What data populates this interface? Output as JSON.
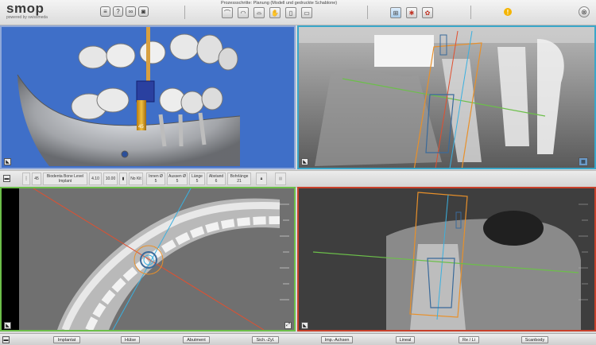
{
  "app": {
    "logo_text": "smop",
    "logo_sub": "powered by swissmeda"
  },
  "toolbar": {
    "process_title": "Prozessschritte: Planung (Modell und gedruckte Schablone)",
    "tools": [
      {
        "icon": "list-icon",
        "glyph": "≡"
      },
      {
        "icon": "help-icon",
        "glyph": "?"
      },
      {
        "icon": "glasses-icon",
        "glyph": "∞"
      },
      {
        "icon": "camera-icon",
        "glyph": "◙"
      }
    ],
    "process_steps": [
      {
        "icon": "model-step-icon",
        "glyph": "⌒"
      },
      {
        "icon": "scan-step-icon",
        "glyph": "◠"
      },
      {
        "icon": "tooth-step-icon",
        "glyph": "⌓"
      },
      {
        "icon": "hand-step-icon",
        "glyph": "✋"
      },
      {
        "icon": "implant-step-icon",
        "glyph": "▯"
      },
      {
        "icon": "guide-step-icon",
        "glyph": "▭"
      }
    ],
    "view_tools": [
      {
        "icon": "layout-icon",
        "glyph": "⊞"
      },
      {
        "icon": "bone-icon",
        "glyph": "✱"
      },
      {
        "icon": "sync-icon",
        "glyph": "✿"
      }
    ],
    "warning_glyph": "!",
    "close_glyph": "⊗"
  },
  "implant_info": {
    "tooth_number": "45",
    "system": "Biodenta Bone Level",
    "type": "Implant",
    "diameter": "4.10",
    "length": "10.00",
    "kit": "No Kit",
    "inner_label": "Innen Ø",
    "inner_value": "5",
    "outer_label": "Aussen Ø",
    "outer_value": "5",
    "len_label": "Länge",
    "len_value": "5",
    "dist_label": "Abstand",
    "dist_value": "6",
    "drill_label": "Bohrlänge",
    "drill_value": "21"
  },
  "bottom_buttons": {
    "implantat": "Implantat",
    "huelse": "Hülse",
    "abutment": "Abutment",
    "sich_zyl": "Sich.-Zyl.",
    "imp_achsen": "Imp.-Achsen",
    "lineal": "Lineal",
    "re_li": "Re / Li",
    "scanbody": "Scanbody"
  },
  "views": {
    "v3d_label": "3D",
    "implant_tag": "45"
  },
  "colors": {
    "view3d_bg": "#3f6fc8",
    "sagittal_border": "#3aa7c9",
    "axial_border": "#6cbf4a",
    "coronal_border": "#c8402a",
    "implant_orange": "#e8902a",
    "axis_blue": "#3ab0e0",
    "axis_green": "#6cbf4a",
    "axis_red": "#e05030"
  }
}
